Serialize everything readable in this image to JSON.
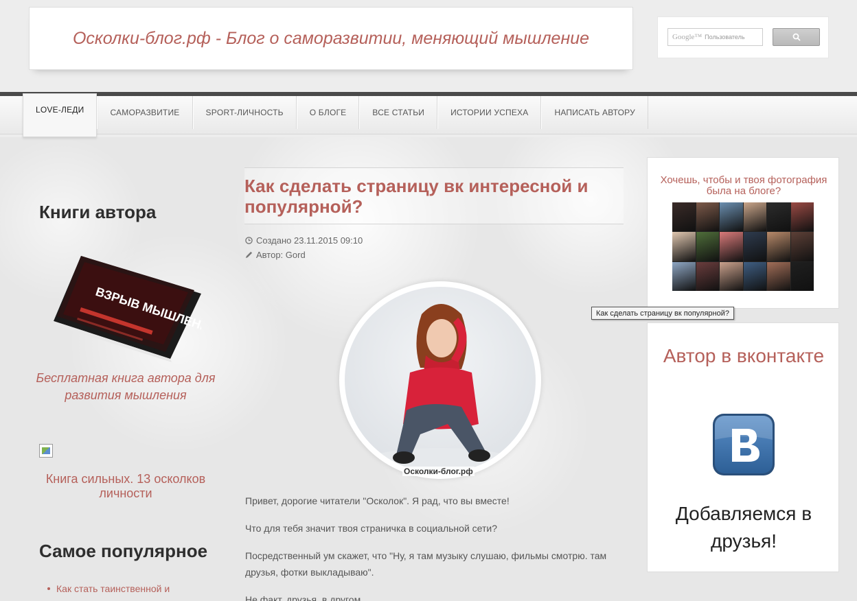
{
  "header": {
    "site_title": "Осколки-блог.рф - Блог о саморазвитии, меняющий мышление",
    "search": {
      "google_label": "Google™",
      "placeholder": "Пользователь"
    }
  },
  "nav": {
    "items": [
      {
        "label": "Love-леди",
        "active": true
      },
      {
        "label": "Саморазвитие",
        "active": false
      },
      {
        "label": "Sport-личность",
        "active": false
      },
      {
        "label": "О блоге",
        "active": false
      },
      {
        "label": "Все статьи",
        "active": false
      },
      {
        "label": "Истории успеха",
        "active": false
      },
      {
        "label": "Написать автору",
        "active": false
      }
    ]
  },
  "left": {
    "books_title": "Книги автора",
    "book_cover_title": "ВЗРЫВ МЫШЛЕНИЯ",
    "book_link": "Бесплатная книга автора для развития мышления",
    "book2_link": "Книга сильных. 13 осколков личности",
    "popular_title": "Самое популярное",
    "popular_items": [
      "Как стать таинственной и"
    ]
  },
  "article": {
    "title": "Как сделать страницу вк интересной и популярной?",
    "created": "Создано 23.11.2015 09:10",
    "author": "Автор: Gord",
    "image_caption": "Осколки-блог.рф",
    "paragraphs": [
      "Привет, дорогие читатели \"Осколок\". Я рад, что вы вместе!",
      "Что для тебя значит твоя страничка в социальной сети?",
      "Посредственный ум скажет, что \"Ну, я там музыку слушаю, фильмы смотрю. там друзья, фотки выкладываю\".",
      "Не факт, друзья, в другом"
    ]
  },
  "right": {
    "photo_title": "Хочешь, чтобы и твоя фотография была на блоге?",
    "tooltip": "Как сделать страницу вк популярной?",
    "vk_title": "Автор в вконтакте",
    "vk_cta": "Добавляемся в друзья!"
  },
  "colors": {
    "accent": "#b5605a",
    "nav_dark": "#4a4a4a"
  }
}
